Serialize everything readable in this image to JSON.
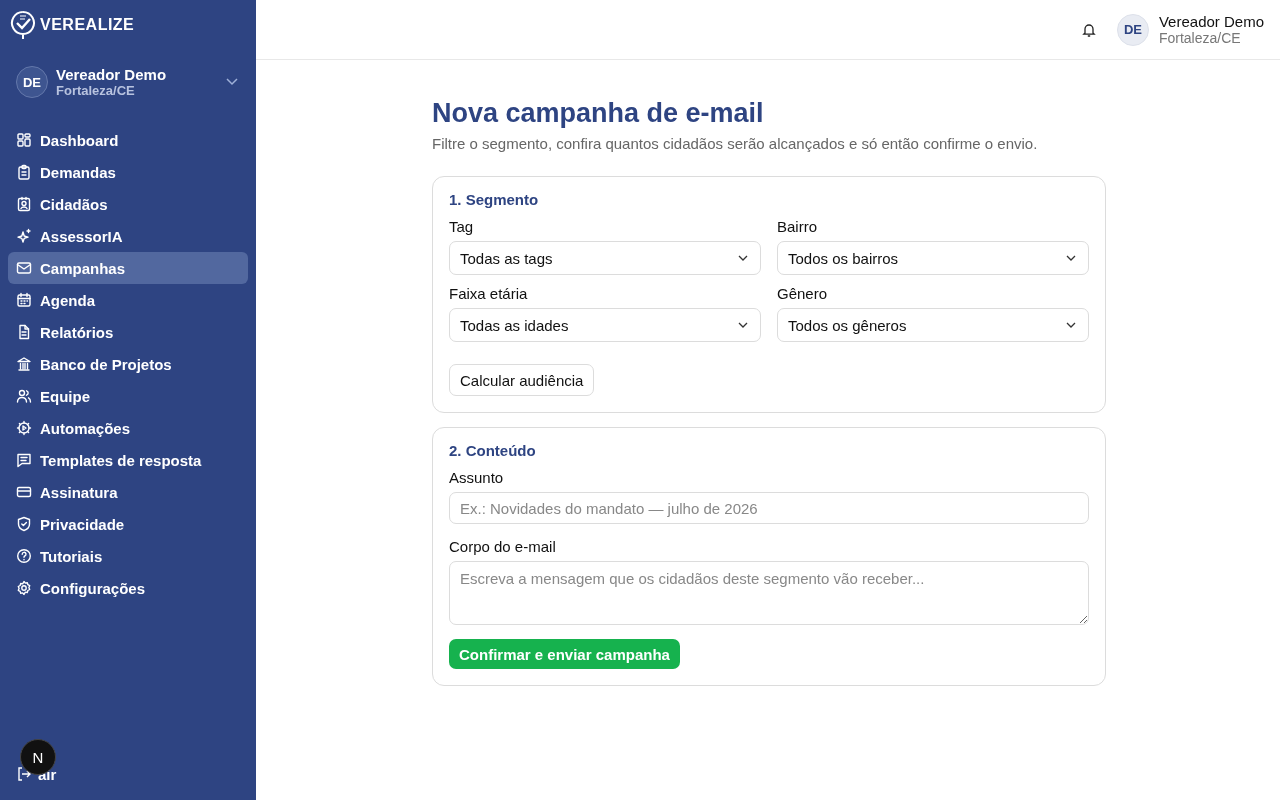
{
  "brand": "VEREALIZE",
  "account": {
    "initials": "DE",
    "name": "Vereador Demo",
    "place": "Fortaleza/CE"
  },
  "nav": [
    {
      "label": "Dashboard",
      "selected": false
    },
    {
      "label": "Demandas",
      "selected": false
    },
    {
      "label": "Cidadãos",
      "selected": false
    },
    {
      "label": "AssessorIA",
      "selected": false
    },
    {
      "label": "Campanhas",
      "selected": true
    },
    {
      "label": "Agenda",
      "selected": false
    },
    {
      "label": "Relatórios",
      "selected": false
    },
    {
      "label": "Banco de Projetos",
      "selected": false
    },
    {
      "label": "Equipe",
      "selected": false
    },
    {
      "label": "Automações",
      "selected": false
    },
    {
      "label": "Templates de resposta",
      "selected": false
    },
    {
      "label": "Assinatura",
      "selected": false
    },
    {
      "label": "Privacidade",
      "selected": false
    },
    {
      "label": "Tutoriais",
      "selected": false
    },
    {
      "label": "Configurações",
      "selected": false
    }
  ],
  "logout": {
    "label": "air"
  },
  "dev_badge": {
    "label": "N"
  },
  "header": {
    "initials": "DE",
    "name": "Vereador Demo",
    "place": "Fortaleza/CE"
  },
  "page": {
    "title": "Nova campanha de e-mail",
    "subtitle": "Filtre o segmento, confira quantos cidadãos serão alcançados e só então confirme o envio."
  },
  "segment": {
    "title": "1. Segmento",
    "filters": [
      {
        "label": "Tag",
        "value": "Todas as tags"
      },
      {
        "label": "Bairro",
        "value": "Todos os bairros"
      },
      {
        "label": "Faixa etária",
        "value": "Todas as idades"
      },
      {
        "label": "Gênero",
        "value": "Todos os gêneros"
      }
    ],
    "button": "Calcular audiência"
  },
  "content": {
    "title": "2. Conteúdo",
    "subject_label": "Assunto",
    "subject_placeholder": "Ex.: Novidades do mandato — julho de 2026",
    "body_label": "Corpo do e-mail",
    "body_placeholder": "Escreva a mensagem que os cidadãos deste segmento vão receber...",
    "submit": "Confirmar e enviar campanha"
  }
}
